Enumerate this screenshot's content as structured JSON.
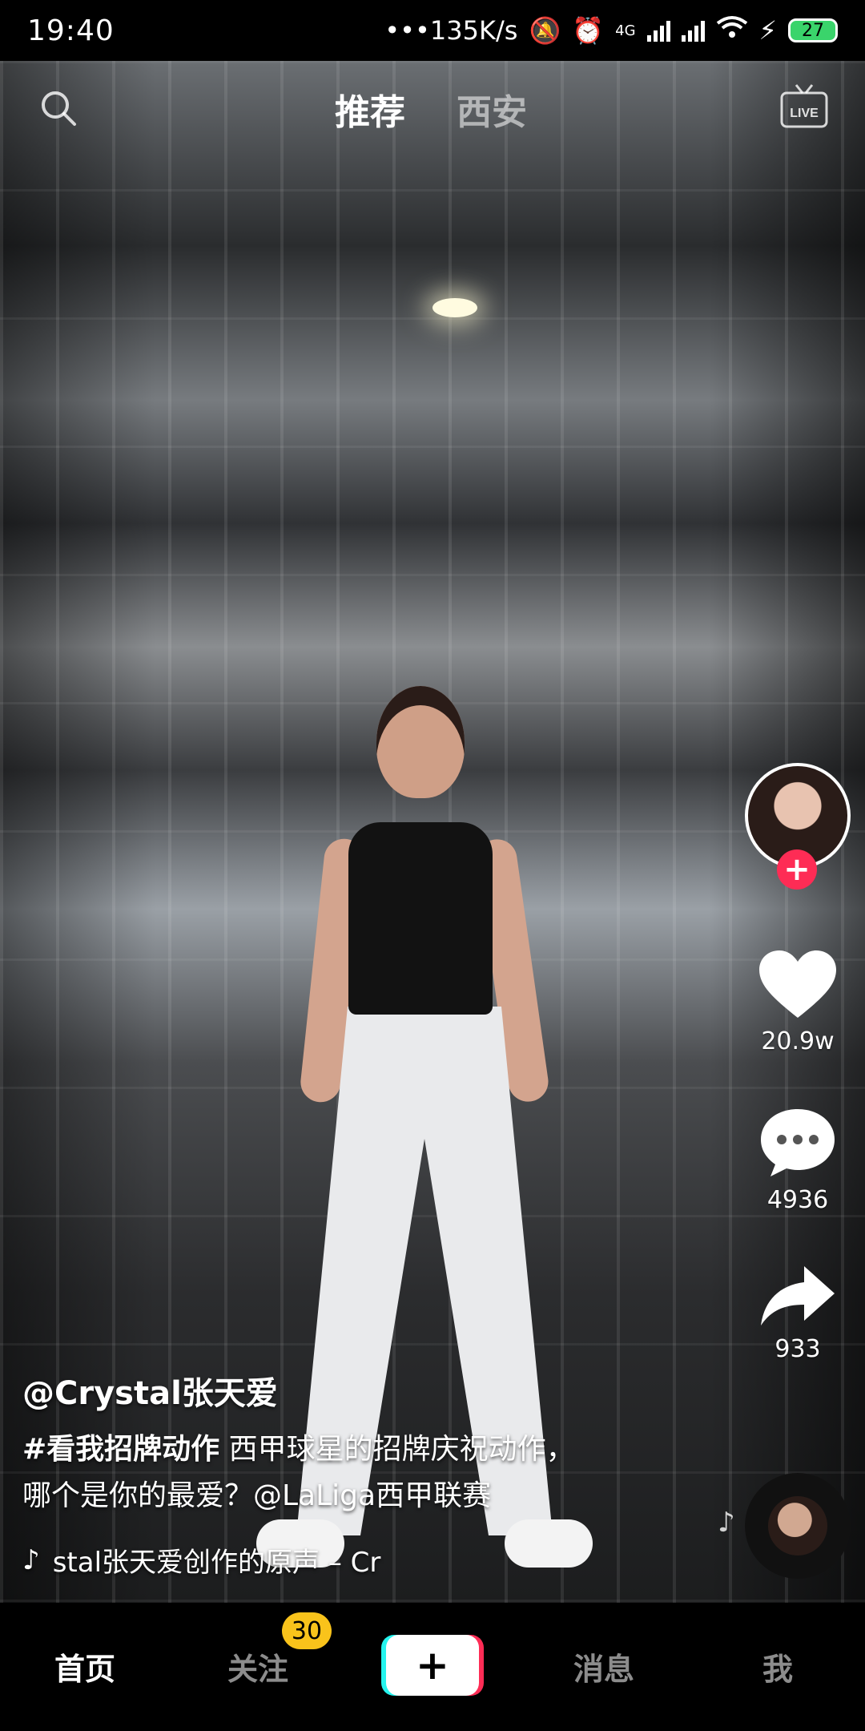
{
  "status_bar": {
    "time": "19:40",
    "net_speed": "•••135K/s",
    "network": "4G",
    "battery": "27"
  },
  "top_nav": {
    "tabs": [
      {
        "label": "推荐",
        "active": true
      },
      {
        "label": "西安",
        "active": false
      }
    ],
    "live_label": "LIVE"
  },
  "video": {
    "author": "@Crystal张天爱",
    "hashtag": "#看我招牌动作",
    "description_line1": " 西甲球星的招牌庆祝动作，",
    "description_line2": "哪个是你的最爱？@LaLiga西甲联赛",
    "music": "stal张天爱创作的原声 – Cr"
  },
  "actions": {
    "likes": "20.9w",
    "comments": "4936",
    "shares": "933",
    "follow_symbol": "+"
  },
  "bottom_nav": {
    "home": "首页",
    "follow": "关注",
    "follow_badge": "30",
    "create": "+",
    "messages": "消息",
    "me": "我"
  },
  "colors": {
    "accent_red": "#fe2c55",
    "accent_cyan": "#25f4ee",
    "badge_yellow": "#f9c31b"
  }
}
